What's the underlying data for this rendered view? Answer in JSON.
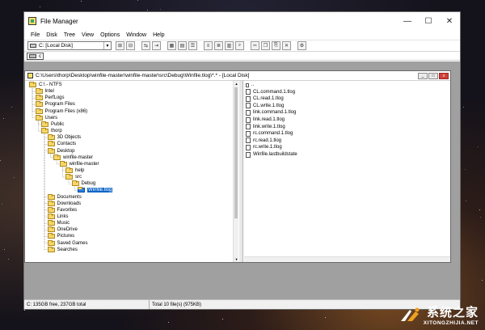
{
  "app": {
    "title": "File Manager"
  },
  "window_controls": {
    "minimize": "—",
    "maximize": "☐",
    "close": "✕"
  },
  "menu": [
    "File",
    "Disk",
    "Tree",
    "View",
    "Options",
    "Window",
    "Help"
  ],
  "toolbar": {
    "drive_select": "C: [Local Disk]"
  },
  "drivebar": {
    "drive": "c"
  },
  "child_window": {
    "title": "C:\\Users\\thorp\\Desktop\\winfile-master\\winfile-master\\src\\Debug\\Winfile.tlog\\*.* - [Local Disk]"
  },
  "tree": [
    {
      "label": "C:\\ - NTFS",
      "depth": 0
    },
    {
      "label": "Intel",
      "depth": 1
    },
    {
      "label": "PerfLogs",
      "depth": 1
    },
    {
      "label": "Program Files",
      "depth": 1
    },
    {
      "label": "Program Files (x86)",
      "depth": 1
    },
    {
      "label": "Users",
      "depth": 1
    },
    {
      "label": "Public",
      "depth": 2
    },
    {
      "label": "thorp",
      "depth": 2
    },
    {
      "label": "3D Objects",
      "depth": 3
    },
    {
      "label": "Contacts",
      "depth": 3
    },
    {
      "label": "Desktop",
      "depth": 3
    },
    {
      "label": "winfile-master",
      "depth": 4
    },
    {
      "label": "winfile-master",
      "depth": 5
    },
    {
      "label": "help",
      "depth": 6
    },
    {
      "label": "src",
      "depth": 6
    },
    {
      "label": "Debug",
      "depth": 7
    },
    {
      "label": "Winfile.tlog",
      "depth": 8,
      "selected": true
    },
    {
      "label": "Documents",
      "depth": 3
    },
    {
      "label": "Downloads",
      "depth": 3
    },
    {
      "label": "Favorites",
      "depth": 3
    },
    {
      "label": "Links",
      "depth": 3
    },
    {
      "label": "Music",
      "depth": 3
    },
    {
      "label": "OneDrive",
      "depth": 3
    },
    {
      "label": "Pictures",
      "depth": 3
    },
    {
      "label": "Saved Games",
      "depth": 3
    },
    {
      "label": "Searches",
      "depth": 3
    }
  ],
  "files": [
    "..",
    "CL.command.1.tlog",
    "CL.read.1.tlog",
    "CL.write.1.tlog",
    "link.command.1.tlog",
    "link.read.1.tlog",
    "link.write.1.tlog",
    "rc.command.1.tlog",
    "rc.read.1.tlog",
    "rc.write.1.tlog",
    "Winfile.lastbuildstate"
  ],
  "status": {
    "disk": "C: 135GB free,  237GB total",
    "files": "Total 10 file(s) (975KB)"
  },
  "watermark": {
    "cn": "系统之家",
    "en": "XITONGZHIJIA.NET"
  }
}
